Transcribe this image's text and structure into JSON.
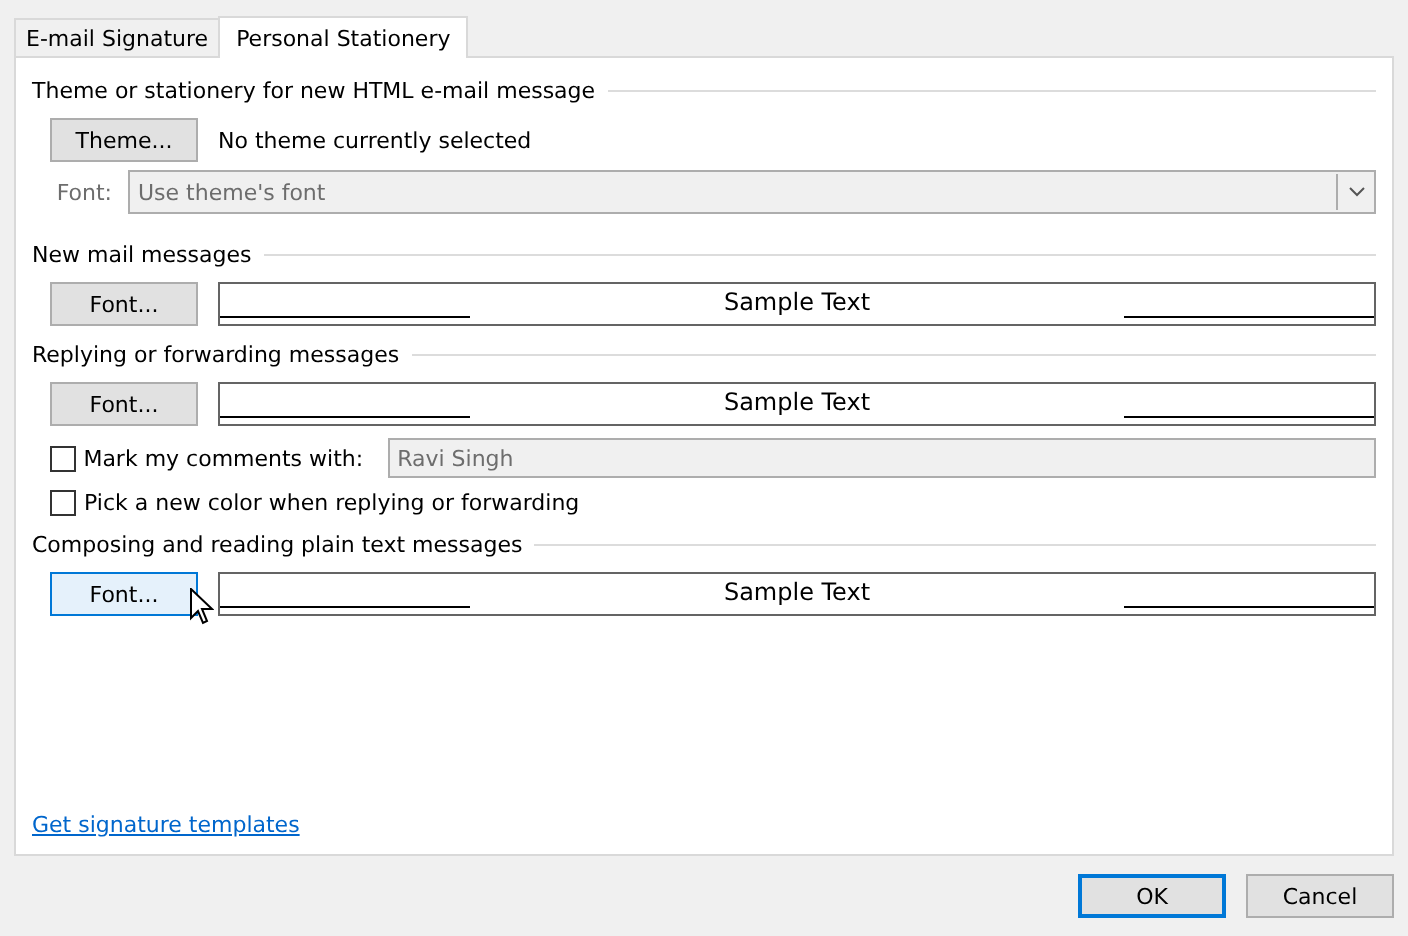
{
  "tabs": [
    {
      "label": "E-mail Signature",
      "selected": false
    },
    {
      "label": "Personal Stationery",
      "selected": true
    }
  ],
  "theme_section": {
    "heading": "Theme or stationery for new HTML e-mail message",
    "button": "Theme...",
    "status": "No theme currently selected",
    "font_label": "Font:",
    "font_value": "Use theme's font",
    "disabled": true
  },
  "font_sections": [
    {
      "heading": "New mail messages",
      "button": "Font...",
      "sample": "Sample Text",
      "hovered": false
    },
    {
      "heading": "Replying or forwarding messages",
      "button": "Font...",
      "sample": "Sample Text",
      "hovered": false,
      "options": [
        {
          "kind": "field",
          "label": "Mark my comments with:",
          "checked": false,
          "value": "Ravi Singh",
          "disabled": true
        },
        {
          "kind": "check",
          "label": "Pick a new color when replying or forwarding",
          "checked": false
        }
      ]
    },
    {
      "heading": "Composing and reading plain text messages",
      "button": "Font...",
      "sample": "Sample Text",
      "hovered": true
    }
  ],
  "link": "Get signature templates",
  "buttons": [
    {
      "label": "OK",
      "default": true
    },
    {
      "label": "Cancel",
      "default": false
    }
  ]
}
